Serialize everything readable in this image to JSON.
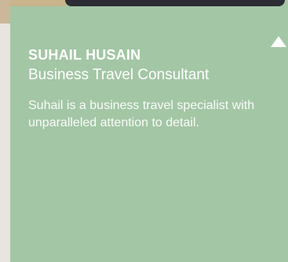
{
  "profile": {
    "name": "SUHAIL HUSAIN",
    "title": "Business Travel Consultant",
    "bio": "Suhail is a business travel specialist with unparalleled attention to detail."
  },
  "colors": {
    "card_background": "#a3c6a5",
    "page_background": "#e8e4df",
    "text": "#ffffff"
  },
  "icons": {
    "toggle": "triangle-up-icon"
  }
}
